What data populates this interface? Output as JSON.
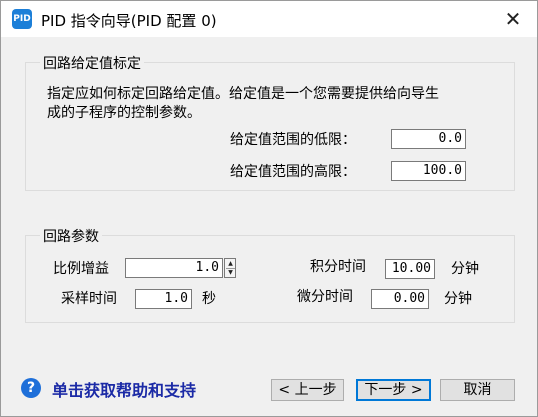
{
  "window": {
    "title": "PID 指令向导(PID 配置 0)",
    "icon_glyph": "PID",
    "close_glyph": "✕"
  },
  "setpoint_group": {
    "label": "回路给定值标定",
    "description_line1": "指定应如何标定回路给定值。给定值是一个您需要提供给向导生",
    "description_line2": "成的子程序的控制参数。",
    "low_label": "给定值范围的低限：",
    "low_value": "0.0",
    "high_label": "给定值范围的高限：",
    "high_value": "100.0"
  },
  "params_group": {
    "label": "回路参数",
    "gain_label": "比例增益",
    "gain_value": "1.0",
    "sample_label": "采样时间",
    "sample_value": "1.0",
    "sample_unit": "秒",
    "integral_label": "积分时间",
    "integral_value": "10.00",
    "integral_unit": "分钟",
    "derivative_label": "微分时间",
    "derivative_value": "0.00",
    "derivative_unit": "分钟"
  },
  "footer": {
    "help_glyph": "?",
    "help_text": "单击获取帮助和支持",
    "prev_label": "< 上一步",
    "next_label": "下一步 >",
    "cancel_label": "取消"
  }
}
